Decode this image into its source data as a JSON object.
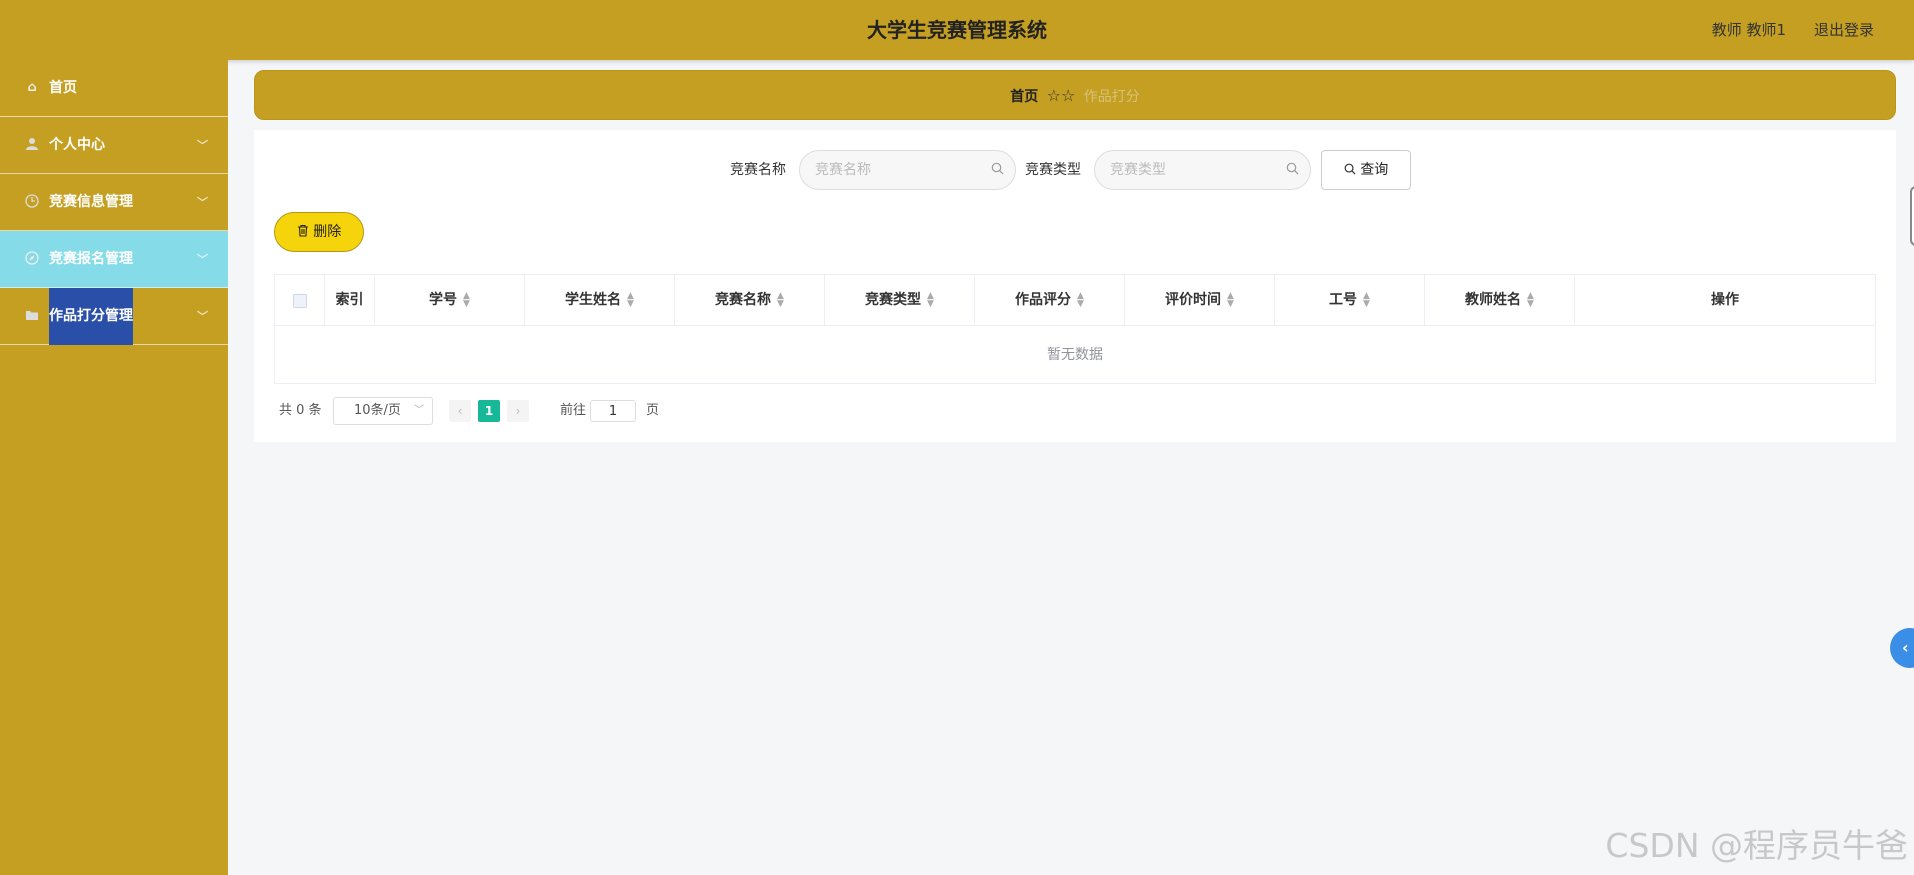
{
  "header": {
    "title": "大学生竞赛管理系统",
    "user": "教师 教师1",
    "logout": "退出登录"
  },
  "sidebar": {
    "items": [
      {
        "label": "首页",
        "icon": "home-icon"
      },
      {
        "label": "个人中心",
        "icon": "user-icon"
      },
      {
        "label": "竞赛信息管理",
        "icon": "clock-icon"
      },
      {
        "label": "竞赛报名管理",
        "icon": "compass-icon"
      },
      {
        "label": "作品打分管理",
        "icon": "folder-icon"
      }
    ],
    "active_color": "#85dbe8",
    "background": "#c49f22"
  },
  "breadcrumb": {
    "home": "首页",
    "current": "作品打分"
  },
  "search": {
    "name_label": "竞赛名称",
    "name_placeholder": "竞赛名称",
    "type_label": "竞赛类型",
    "type_placeholder": "竞赛类型",
    "query_label": "查询"
  },
  "toolbar": {
    "delete_label": "删除"
  },
  "table": {
    "columns": [
      "索引",
      "学号",
      "学生姓名",
      "竞赛名称",
      "竞赛类型",
      "作品评分",
      "评价时间",
      "工号",
      "教师姓名",
      "操作"
    ],
    "empty_text": "暂无数据"
  },
  "pagination": {
    "total": "共 0 条",
    "page_size": "10条/页",
    "current_page": "1",
    "goto_label": "前往",
    "goto_value": "1",
    "page_unit": "页"
  },
  "watermark": "CSDN @程序员牛爸"
}
